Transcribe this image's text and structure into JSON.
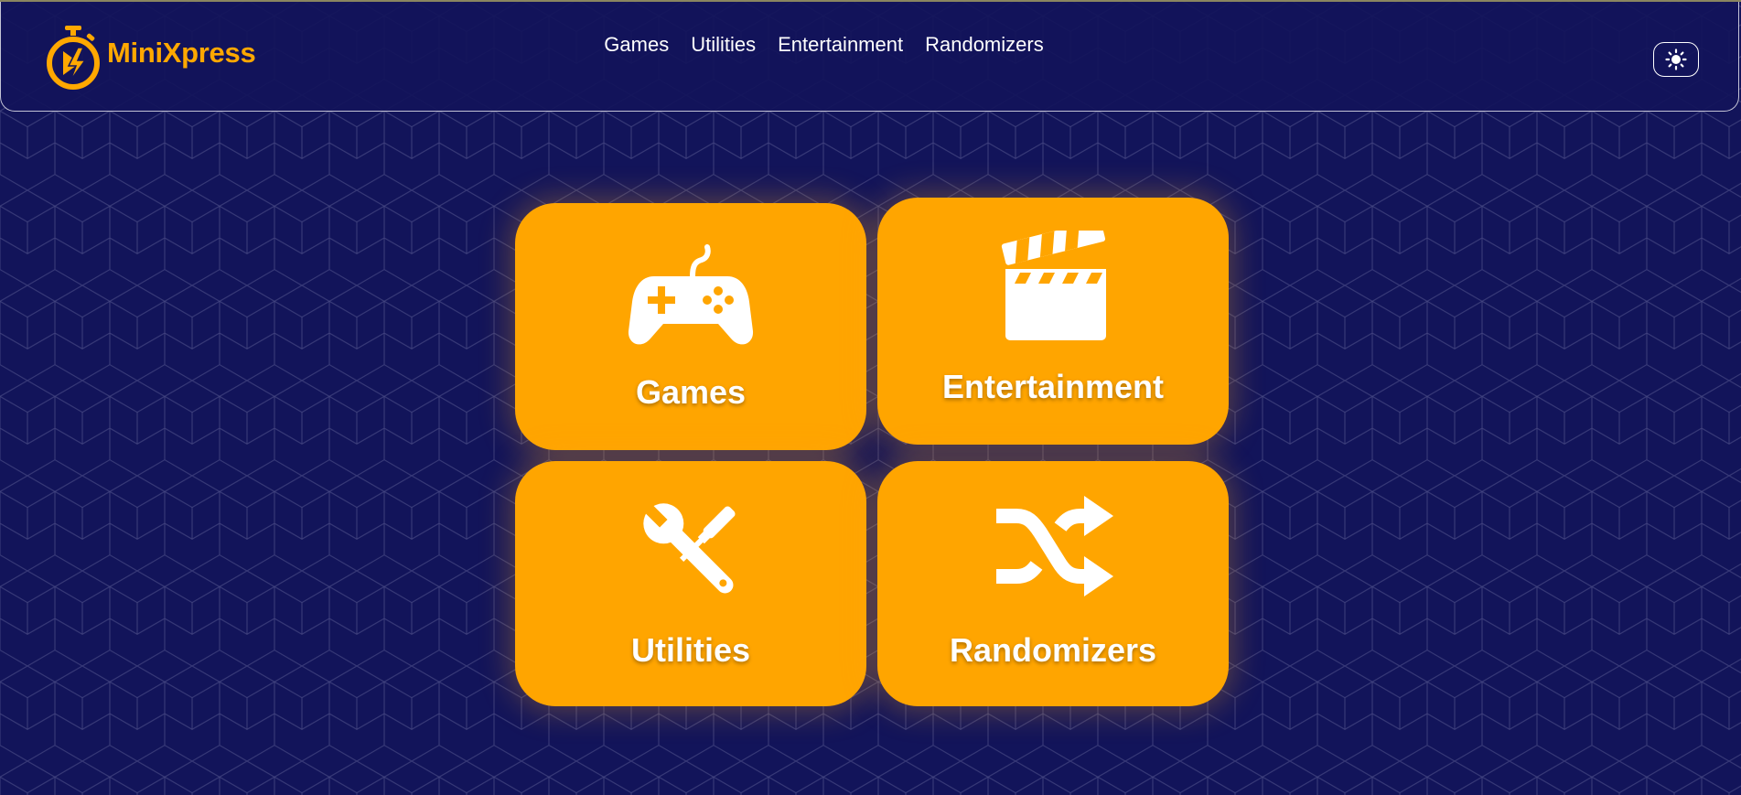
{
  "brand": {
    "name": "MiniXpress",
    "accent_color": "#ffa800",
    "logo_icon": "stopwatch-lightning-icon"
  },
  "nav": {
    "links": [
      {
        "label": "Games"
      },
      {
        "label": "Utilities"
      },
      {
        "label": "Entertainment"
      },
      {
        "label": "Randomizers"
      }
    ]
  },
  "theme_toggle": {
    "icon": "sun-icon"
  },
  "colors": {
    "background": "#12145a",
    "card": "#ffa500",
    "card_text": "#ffffff",
    "grid_lines": "#4a4c86"
  },
  "cards": [
    {
      "label": "Games",
      "icon": "gamepad-icon"
    },
    {
      "label": "Entertainment",
      "icon": "clapperboard-icon"
    },
    {
      "label": "Utilities",
      "icon": "tools-icon"
    },
    {
      "label": "Randomizers",
      "icon": "shuffle-icon"
    }
  ]
}
